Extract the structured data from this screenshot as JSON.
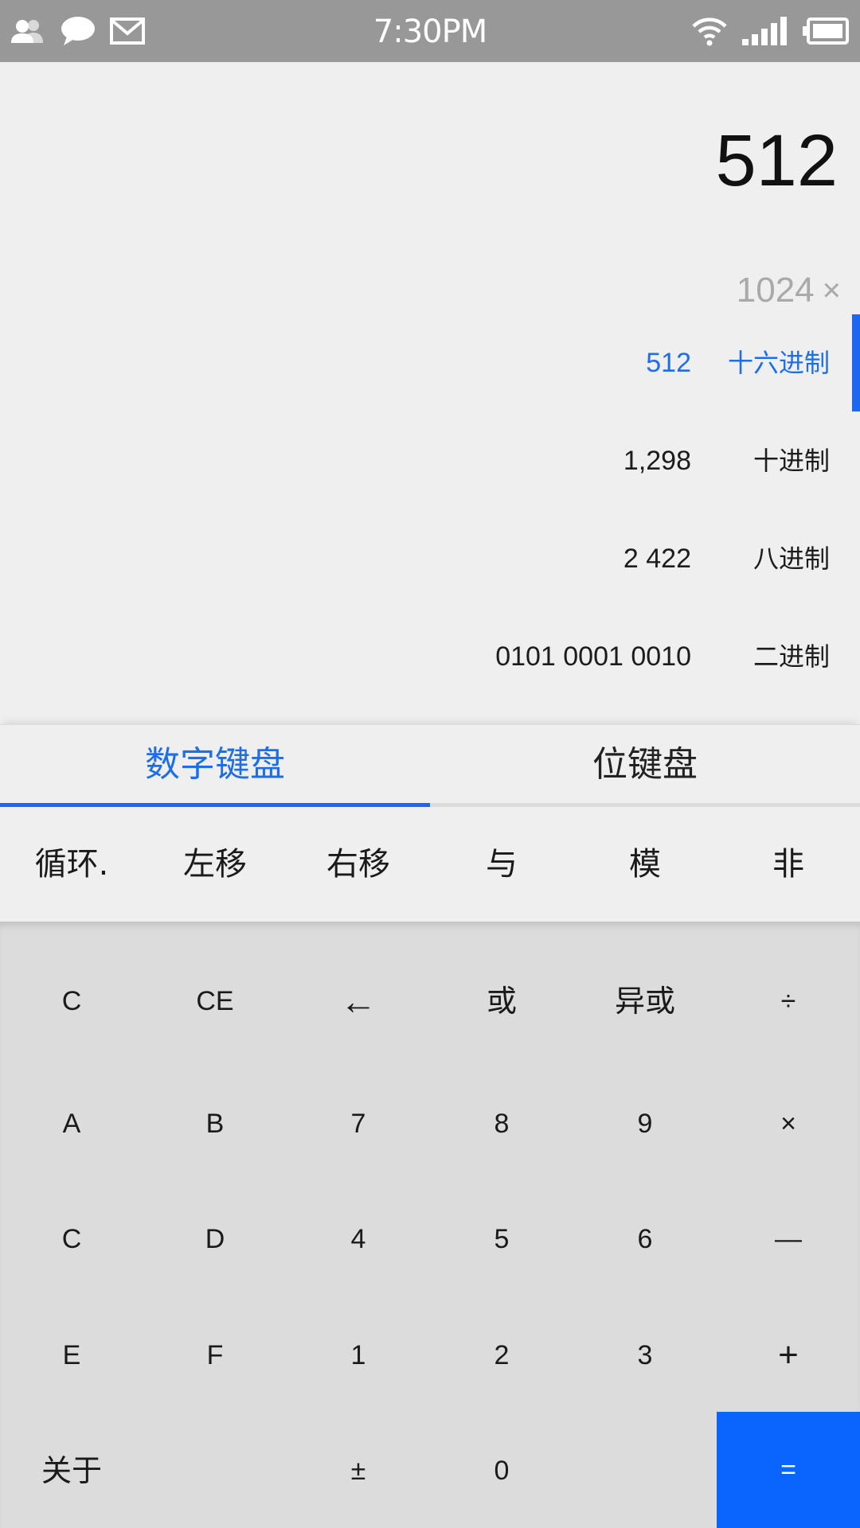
{
  "status_bar": {
    "time": "7:30PM",
    "left_icons": [
      "contacts-icon",
      "message-bubble-icon",
      "mail-icon"
    ],
    "right_icons": [
      "wifi-icon",
      "cell-signal-icon",
      "battery-icon"
    ]
  },
  "display": {
    "result": "512",
    "history_value": "1024",
    "history_operator": "×",
    "bases": [
      {
        "value": "512",
        "label": "十六进制",
        "active": true
      },
      {
        "value": "1,298",
        "label": "十进制",
        "active": false
      },
      {
        "value": "2 422",
        "label": "八进制",
        "active": false
      },
      {
        "value": "0101 0001 0010",
        "label": "二进制",
        "active": false
      }
    ]
  },
  "tabs": [
    {
      "label": "数字键盘",
      "active": true
    },
    {
      "label": "位键盘",
      "active": false
    }
  ],
  "bit_ops": [
    "循环.",
    "左移",
    "右移",
    "与",
    "模",
    "非"
  ],
  "keypad": {
    "row1": [
      "C",
      "CE",
      "←",
      "或",
      "异或",
      "÷"
    ],
    "row2": [
      "A",
      "B",
      "7",
      "8",
      "9",
      "×"
    ],
    "row3": [
      "C",
      "D",
      "4",
      "5",
      "6",
      "—"
    ],
    "row4": [
      "E",
      "F",
      "1",
      "2",
      "3",
      "+"
    ],
    "row5": [
      "关于",
      "",
      "±",
      "0",
      "",
      "="
    ]
  },
  "colors": {
    "accent": "#1d66f0",
    "equals_bg": "#0a65ff",
    "status_bar": "#989898",
    "keypad_bg": "#dcdcdd",
    "display_bg": "#efeff0"
  }
}
